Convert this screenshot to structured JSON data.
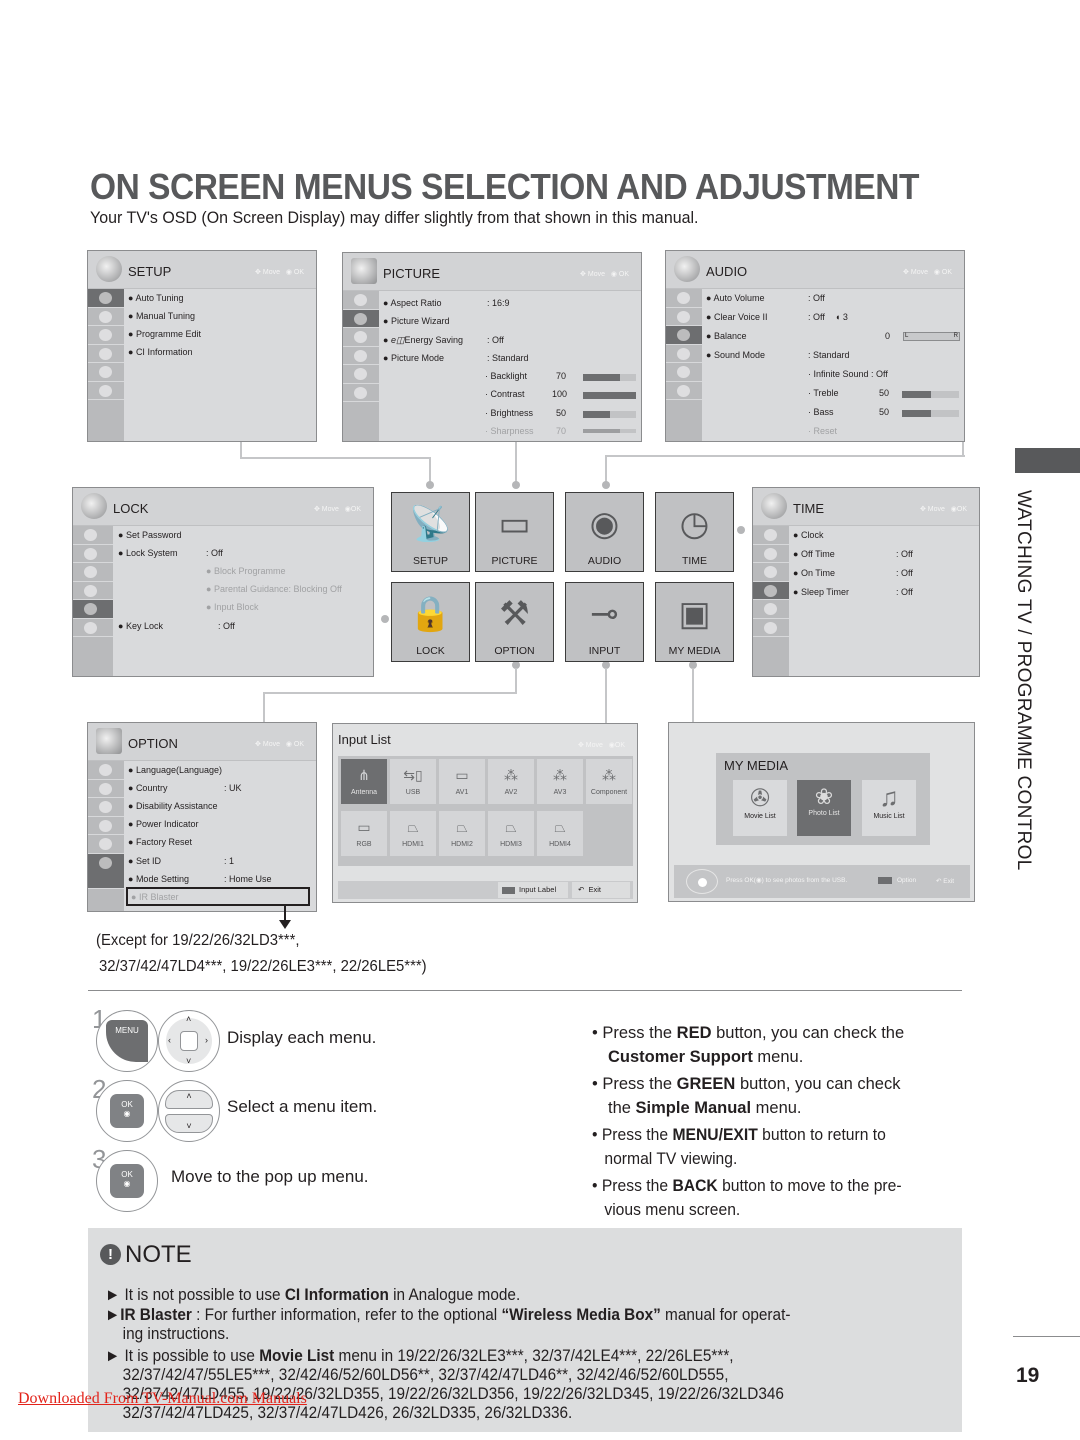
{
  "page": {
    "title": "ON SCREEN MENUS SELECTION AND ADJUSTMENT",
    "subtitle": "Your TV's OSD (On Screen Display) may differ slightly from that shown in this manual.",
    "side_tab": "WATCHING TV / PROGRAMME CONTROL",
    "page_number": "19",
    "footer_link": "Downloaded From TV-Manual.com Manuals"
  },
  "nav_hint": {
    "move": "Move",
    "ok": "OK"
  },
  "setup": {
    "title": "SETUP",
    "items": [
      "Auto Tuning",
      "Manual Tuning",
      "Programme Edit",
      "CI Information"
    ]
  },
  "picture": {
    "title": "PICTURE",
    "items": [
      {
        "label": "Aspect Ratio",
        "value": ": 16:9"
      },
      {
        "label": "Picture Wizard",
        "value": ""
      },
      {
        "label": "Energy Saving",
        "value": ": Off"
      },
      {
        "label": "Picture Mode",
        "value": ": Standard"
      }
    ],
    "sub": [
      {
        "label": "Backlight",
        "value": "70",
        "level": 70
      },
      {
        "label": "Contrast",
        "value": "100",
        "level": 100
      },
      {
        "label": "Brightness",
        "value": "50",
        "level": 50
      },
      {
        "label": "Sharpness",
        "value": "70",
        "level": 70
      }
    ]
  },
  "audio": {
    "title": "AUDIO",
    "items": [
      {
        "label": "Auto Volume",
        "value": ": Off"
      },
      {
        "label": "Clear Voice II",
        "value": ": Off",
        "extra": "3"
      },
      {
        "label": "Balance",
        "value": "0",
        "left": "L",
        "right": "R"
      },
      {
        "label": "Sound Mode",
        "value": ": Standard"
      }
    ],
    "sub": [
      {
        "label": "Infinite Sound : Off"
      },
      {
        "label": "Treble",
        "value": "50",
        "level": 50
      },
      {
        "label": "Bass",
        "value": "50",
        "level": 50
      },
      {
        "label": "Reset"
      }
    ]
  },
  "lock": {
    "title": "LOCK",
    "items": [
      {
        "label": "Set Password",
        "value": ""
      },
      {
        "label": "Lock System",
        "value": ": Off"
      },
      {
        "label": "Key Lock",
        "value": ": Off"
      }
    ],
    "sub": [
      "Block Programme",
      "Parental Guidance: Blocking Off",
      "Input Block"
    ]
  },
  "time": {
    "title": "TIME",
    "items": [
      {
        "label": "Clock",
        "value": ""
      },
      {
        "label": "Off Time",
        "value": ": Off"
      },
      {
        "label": "On Time",
        "value": ": Off"
      },
      {
        "label": "Sleep Timer",
        "value": ": Off"
      }
    ]
  },
  "menu_grid": [
    {
      "label": "SETUP",
      "icon": "satellite-dish-icon",
      "glyph": "📡"
    },
    {
      "label": "PICTURE",
      "icon": "tv-icon",
      "glyph": "▭"
    },
    {
      "label": "AUDIO",
      "icon": "speaker-icon",
      "glyph": "◉"
    },
    {
      "label": "TIME",
      "icon": "clock-icon",
      "glyph": "◷"
    },
    {
      "label": "LOCK",
      "icon": "padlock-icon",
      "glyph": "🔒"
    },
    {
      "label": "OPTION",
      "icon": "toolbox-icon",
      "glyph": "⚒"
    },
    {
      "label": "INPUT",
      "icon": "cable-icon",
      "glyph": "⊸"
    },
    {
      "label": "MY MEDIA",
      "icon": "media-icon",
      "glyph": "▣"
    }
  ],
  "option": {
    "title": "OPTION",
    "items": [
      {
        "label": "Language(Language)",
        "value": ""
      },
      {
        "label": "Country",
        "value": ": UK"
      },
      {
        "label": "Disability Assistance",
        "value": ""
      },
      {
        "label": "Power Indicator",
        "value": ""
      },
      {
        "label": "Factory Reset",
        "value": ""
      },
      {
        "label": "Set ID",
        "value": ": 1"
      },
      {
        "label": "Mode Setting",
        "value": ": Home Use"
      },
      {
        "label": "IR Blaster",
        "value": ""
      }
    ]
  },
  "input_list": {
    "title": "Input List",
    "row1": [
      "Antenna",
      "USB",
      "AV1",
      "AV2",
      "AV3",
      "Component"
    ],
    "row2": [
      "RGB",
      "HDMI1",
      "HDMI2",
      "HDMI3",
      "HDMI4"
    ],
    "input_label": "Input Label",
    "exit": "Exit"
  },
  "my_media": {
    "title": "MY MEDIA",
    "items": [
      "Movie List",
      "Photo List",
      "Music List"
    ],
    "hint": "Press OK(◉) to see photos from the USB.",
    "option": "Option",
    "exit": "Exit"
  },
  "except_note": {
    "line1": "(Except for 19/22/26/32LD3***,",
    "line2": "32/37/42/47LD4***, 19/22/26LE3***, 22/26LE5***)"
  },
  "steps": [
    {
      "num": "1",
      "button": "MENU",
      "text": "Display each menu."
    },
    {
      "num": "2",
      "button": "OK",
      "text": "Select a menu item."
    },
    {
      "num": "3",
      "button": "OK",
      "text": "Move to the pop up menu."
    }
  ],
  "bullets": [
    {
      "a": "Press the ",
      "b": "RED",
      "c": " button, you can check the",
      "d_bold": "Customer Support",
      "d": " menu."
    },
    {
      "a": "Press the ",
      "b": "GREEN",
      "c": " button, you can check",
      "d_pre": "the ",
      "d_bold": "Simple Manual",
      "d": " menu."
    },
    {
      "a": "Press the ",
      "b": "MENU/EXIT",
      "c": " button to return to",
      "d": "normal TV viewing."
    },
    {
      "a": "Press the ",
      "b": "BACK",
      "c": " button to move to the pre-",
      "d": "vious menu screen."
    }
  ],
  "note": {
    "title": "NOTE",
    "lines": [
      {
        "a": "It is not possible to use ",
        "b": "CI Information",
        "c": " in Analogue mode."
      },
      {
        "a": "",
        "b": "IR Blaster",
        "c": " : For further information, refer to the optional ",
        "d": "“Wireless Media Box”",
        "e": " manual for operat-",
        "cont": "ing instructions."
      },
      {
        "a": "It is possible to use ",
        "b": "Movie List",
        "c": " menu in 19/22/26/32LE3***, 32/37/42LE4***, 22/26LE5***,",
        "cont": [
          "32/37/42/47/55LE5***, 32/42/46/52/60LD56**, 32/37/42/47LD46**, 32/42/46/52/60LD555,",
          "32/3742/47LD455, 19/22/26/32LD355, 19/22/26/32LD356, 19/22/26/32LD345, 19/22/26/32LD346",
          "32/37/42/47LD425, 32/37/42/47LD426, 26/32LD335, 26/32LD336."
        ]
      }
    ]
  }
}
